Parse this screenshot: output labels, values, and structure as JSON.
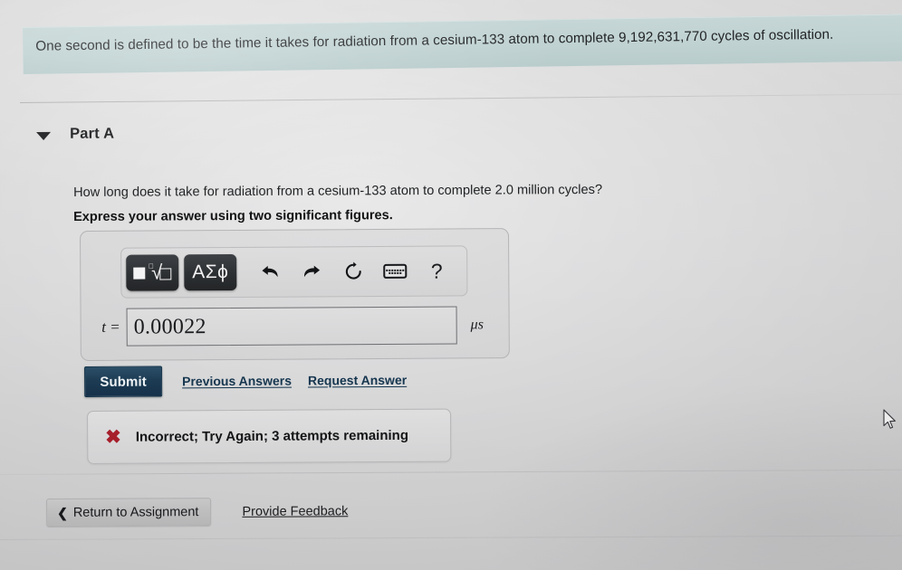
{
  "banner": {
    "text": "One second is defined to be the time it takes for radiation from a cesium-133 atom to complete 9,192,631,770 cycles of oscillation. "
  },
  "part": {
    "caret_icon": "caret-down-icon",
    "title": "Part A"
  },
  "question": {
    "prompt": "How long does it take for radiation from a cesium-133 atom to complete 2.0 million cycles?",
    "instruction": "Express your answer using two significant figures."
  },
  "mathbar": {
    "template_button_label": "□√□",
    "template_index": "□",
    "greek_button_label": "ΑΣϕ",
    "undo_icon": "undo-arrow-icon",
    "redo_icon": "redo-arrow-icon",
    "reset_icon": "reset-circular-arrow-icon",
    "keyboard_icon": "keyboard-icon",
    "help_label": "?"
  },
  "answer": {
    "variable_label": "t =",
    "value": "0.00022",
    "placeholder": "",
    "unit": "μs"
  },
  "actions": {
    "submit_label": "Submit",
    "previous_answers_label": "Previous Answers",
    "request_answer_label": "Request Answer"
  },
  "feedback": {
    "icon": "incorrect-x-icon",
    "icon_glyph": "✖",
    "message": "Incorrect; Try Again; 3 attempts remaining"
  },
  "bottom": {
    "chevron": "❮",
    "return_label": "Return to Assignment",
    "provide_feedback_label": "Provide Feedback"
  },
  "colors": {
    "banner_bg": "#c0d2d2",
    "submit_bg": "#1d3c54",
    "link": "#16364f",
    "error_red": "#a61f2b",
    "page_bg": "#cdcdce"
  }
}
